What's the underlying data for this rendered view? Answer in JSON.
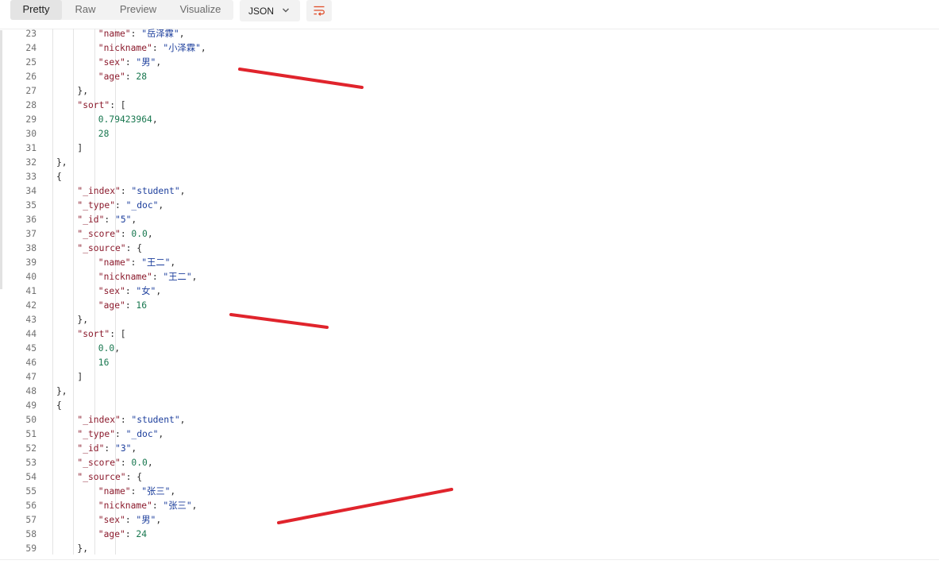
{
  "toolbar": {
    "tabs": [
      {
        "label": "Pretty",
        "active": true
      },
      {
        "label": "Raw",
        "active": false
      },
      {
        "label": "Preview",
        "active": false
      },
      {
        "label": "Visualize",
        "active": false
      }
    ],
    "format": {
      "value": "JSON",
      "icon": "chevron-down-icon"
    },
    "wrap_icon": "wrap-lines-icon"
  },
  "colors": {
    "key": "#8b1a2c",
    "string": "#1c3e9c",
    "number": "#18774f",
    "punct": "#2b2b2b",
    "annotation": "#e0242c",
    "wrap_icon": "#e04e2b"
  },
  "code_lines": [
    {
      "n": "23",
      "d": 5,
      "t": [
        [
          "k",
          "\"name\""
        ],
        [
          "p",
          ": "
        ],
        [
          "s",
          "\"岳泽霖\""
        ],
        [
          "p",
          ","
        ]
      ]
    },
    {
      "n": "24",
      "d": 5,
      "t": [
        [
          "k",
          "\"nickname\""
        ],
        [
          "p",
          ": "
        ],
        [
          "s",
          "\"小泽霖\""
        ],
        [
          "p",
          ","
        ]
      ]
    },
    {
      "n": "25",
      "d": 5,
      "t": [
        [
          "k",
          "\"sex\""
        ],
        [
          "p",
          ": "
        ],
        [
          "s",
          "\"男\""
        ],
        [
          "p",
          ","
        ]
      ]
    },
    {
      "n": "26",
      "d": 5,
      "t": [
        [
          "k",
          "\"age\""
        ],
        [
          "p",
          ": "
        ],
        [
          "n",
          "28"
        ]
      ]
    },
    {
      "n": "27",
      "d": 4,
      "t": [
        [
          "p",
          "},"
        ]
      ]
    },
    {
      "n": "28",
      "d": 4,
      "t": [
        [
          "k",
          "\"sort\""
        ],
        [
          "p",
          ": ["
        ]
      ]
    },
    {
      "n": "29",
      "d": 5,
      "t": [
        [
          "n",
          "0.79423964"
        ],
        [
          "p",
          ","
        ]
      ]
    },
    {
      "n": "30",
      "d": 5,
      "t": [
        [
          "n",
          "28"
        ]
      ]
    },
    {
      "n": "31",
      "d": 4,
      "t": [
        [
          "p",
          "]"
        ]
      ]
    },
    {
      "n": "32",
      "d": 3,
      "t": [
        [
          "p",
          "},"
        ]
      ]
    },
    {
      "n": "33",
      "d": 3,
      "t": [
        [
          "p",
          "{"
        ]
      ]
    },
    {
      "n": "34",
      "d": 4,
      "t": [
        [
          "k",
          "\"_index\""
        ],
        [
          "p",
          ": "
        ],
        [
          "s",
          "\"student\""
        ],
        [
          "p",
          ","
        ]
      ]
    },
    {
      "n": "35",
      "d": 4,
      "t": [
        [
          "k",
          "\"_type\""
        ],
        [
          "p",
          ": "
        ],
        [
          "s",
          "\"_doc\""
        ],
        [
          "p",
          ","
        ]
      ]
    },
    {
      "n": "36",
      "d": 4,
      "t": [
        [
          "k",
          "\"_id\""
        ],
        [
          "p",
          ": "
        ],
        [
          "s",
          "\"5\""
        ],
        [
          "p",
          ","
        ]
      ]
    },
    {
      "n": "37",
      "d": 4,
      "t": [
        [
          "k",
          "\"_score\""
        ],
        [
          "p",
          ": "
        ],
        [
          "n",
          "0.0"
        ],
        [
          "p",
          ","
        ]
      ]
    },
    {
      "n": "38",
      "d": 4,
      "t": [
        [
          "k",
          "\"_source\""
        ],
        [
          "p",
          ": {"
        ]
      ]
    },
    {
      "n": "39",
      "d": 5,
      "t": [
        [
          "k",
          "\"name\""
        ],
        [
          "p",
          ": "
        ],
        [
          "s",
          "\"王二\""
        ],
        [
          "p",
          ","
        ]
      ]
    },
    {
      "n": "40",
      "d": 5,
      "t": [
        [
          "k",
          "\"nickname\""
        ],
        [
          "p",
          ": "
        ],
        [
          "s",
          "\"王二\""
        ],
        [
          "p",
          ","
        ]
      ]
    },
    {
      "n": "41",
      "d": 5,
      "t": [
        [
          "k",
          "\"sex\""
        ],
        [
          "p",
          ": "
        ],
        [
          "s",
          "\"女\""
        ],
        [
          "p",
          ","
        ]
      ]
    },
    {
      "n": "42",
      "d": 5,
      "t": [
        [
          "k",
          "\"age\""
        ],
        [
          "p",
          ": "
        ],
        [
          "n",
          "16"
        ]
      ]
    },
    {
      "n": "43",
      "d": 4,
      "t": [
        [
          "p",
          "},"
        ]
      ]
    },
    {
      "n": "44",
      "d": 4,
      "t": [
        [
          "k",
          "\"sort\""
        ],
        [
          "p",
          ": ["
        ]
      ]
    },
    {
      "n": "45",
      "d": 5,
      "t": [
        [
          "n",
          "0.0"
        ],
        [
          "p",
          ","
        ]
      ]
    },
    {
      "n": "46",
      "d": 5,
      "t": [
        [
          "n",
          "16"
        ]
      ]
    },
    {
      "n": "47",
      "d": 4,
      "t": [
        [
          "p",
          "]"
        ]
      ]
    },
    {
      "n": "48",
      "d": 3,
      "t": [
        [
          "p",
          "},"
        ]
      ]
    },
    {
      "n": "49",
      "d": 3,
      "t": [
        [
          "p",
          "{"
        ]
      ]
    },
    {
      "n": "50",
      "d": 4,
      "t": [
        [
          "k",
          "\"_index\""
        ],
        [
          "p",
          ": "
        ],
        [
          "s",
          "\"student\""
        ],
        [
          "p",
          ","
        ]
      ]
    },
    {
      "n": "51",
      "d": 4,
      "t": [
        [
          "k",
          "\"_type\""
        ],
        [
          "p",
          ": "
        ],
        [
          "s",
          "\"_doc\""
        ],
        [
          "p",
          ","
        ]
      ]
    },
    {
      "n": "52",
      "d": 4,
      "t": [
        [
          "k",
          "\"_id\""
        ],
        [
          "p",
          ": "
        ],
        [
          "s",
          "\"3\""
        ],
        [
          "p",
          ","
        ]
      ]
    },
    {
      "n": "53",
      "d": 4,
      "t": [
        [
          "k",
          "\"_score\""
        ],
        [
          "p",
          ": "
        ],
        [
          "n",
          "0.0"
        ],
        [
          "p",
          ","
        ]
      ]
    },
    {
      "n": "54",
      "d": 4,
      "t": [
        [
          "k",
          "\"_source\""
        ],
        [
          "p",
          ": {"
        ]
      ]
    },
    {
      "n": "55",
      "d": 5,
      "t": [
        [
          "k",
          "\"name\""
        ],
        [
          "p",
          ": "
        ],
        [
          "s",
          "\"张三\""
        ],
        [
          "p",
          ","
        ]
      ]
    },
    {
      "n": "56",
      "d": 5,
      "t": [
        [
          "k",
          "\"nickname\""
        ],
        [
          "p",
          ": "
        ],
        [
          "s",
          "\"张三\""
        ],
        [
          "p",
          ","
        ]
      ]
    },
    {
      "n": "57",
      "d": 5,
      "t": [
        [
          "k",
          "\"sex\""
        ],
        [
          "p",
          ": "
        ],
        [
          "s",
          "\"男\""
        ],
        [
          "p",
          ","
        ]
      ]
    },
    {
      "n": "58",
      "d": 5,
      "t": [
        [
          "k",
          "\"age\""
        ],
        [
          "p",
          ": "
        ],
        [
          "n",
          "24"
        ]
      ]
    },
    {
      "n": "59",
      "d": 4,
      "t": [
        [
          "p",
          "},"
        ]
      ]
    }
  ]
}
